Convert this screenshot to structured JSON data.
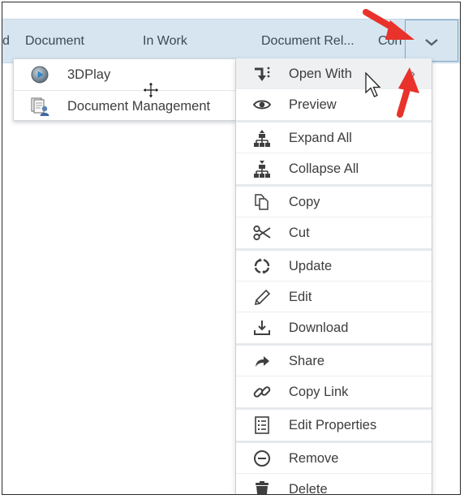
{
  "header": {
    "truncated_cell": "d",
    "columns": [
      "Document",
      "In Work",
      "Document Rel...",
      "Con"
    ]
  },
  "submenu": {
    "items": [
      {
        "label": "3DPlay",
        "icon": "3dplay-icon"
      },
      {
        "label": "Document Management",
        "icon": "document-management-icon"
      }
    ]
  },
  "context_menu": {
    "groups": [
      [
        {
          "label": "Open With",
          "icon": "open-with-icon",
          "has_submenu": true,
          "highlighted": true
        },
        {
          "label": "Preview",
          "icon": "eye-icon"
        }
      ],
      [
        {
          "label": "Expand All",
          "icon": "expand-all-icon"
        },
        {
          "label": "Collapse All",
          "icon": "collapse-all-icon"
        }
      ],
      [
        {
          "label": "Copy",
          "icon": "copy-icon"
        },
        {
          "label": "Cut",
          "icon": "scissors-icon"
        }
      ],
      [
        {
          "label": "Update",
          "icon": "update-icon"
        },
        {
          "label": "Edit",
          "icon": "pencil-icon"
        },
        {
          "label": "Download",
          "icon": "download-icon"
        }
      ],
      [
        {
          "label": "Share",
          "icon": "share-icon"
        },
        {
          "label": "Copy Link",
          "icon": "link-icon"
        }
      ],
      [
        {
          "label": "Edit Properties",
          "icon": "properties-icon"
        }
      ],
      [
        {
          "label": "Remove",
          "icon": "remove-icon"
        },
        {
          "label": "Delete",
          "icon": "trash-icon"
        }
      ]
    ]
  },
  "colors": {
    "header_bg": "#d6e5f0",
    "highlight_bg": "#eef0f2",
    "annotation_arrow": "#e8322b"
  }
}
